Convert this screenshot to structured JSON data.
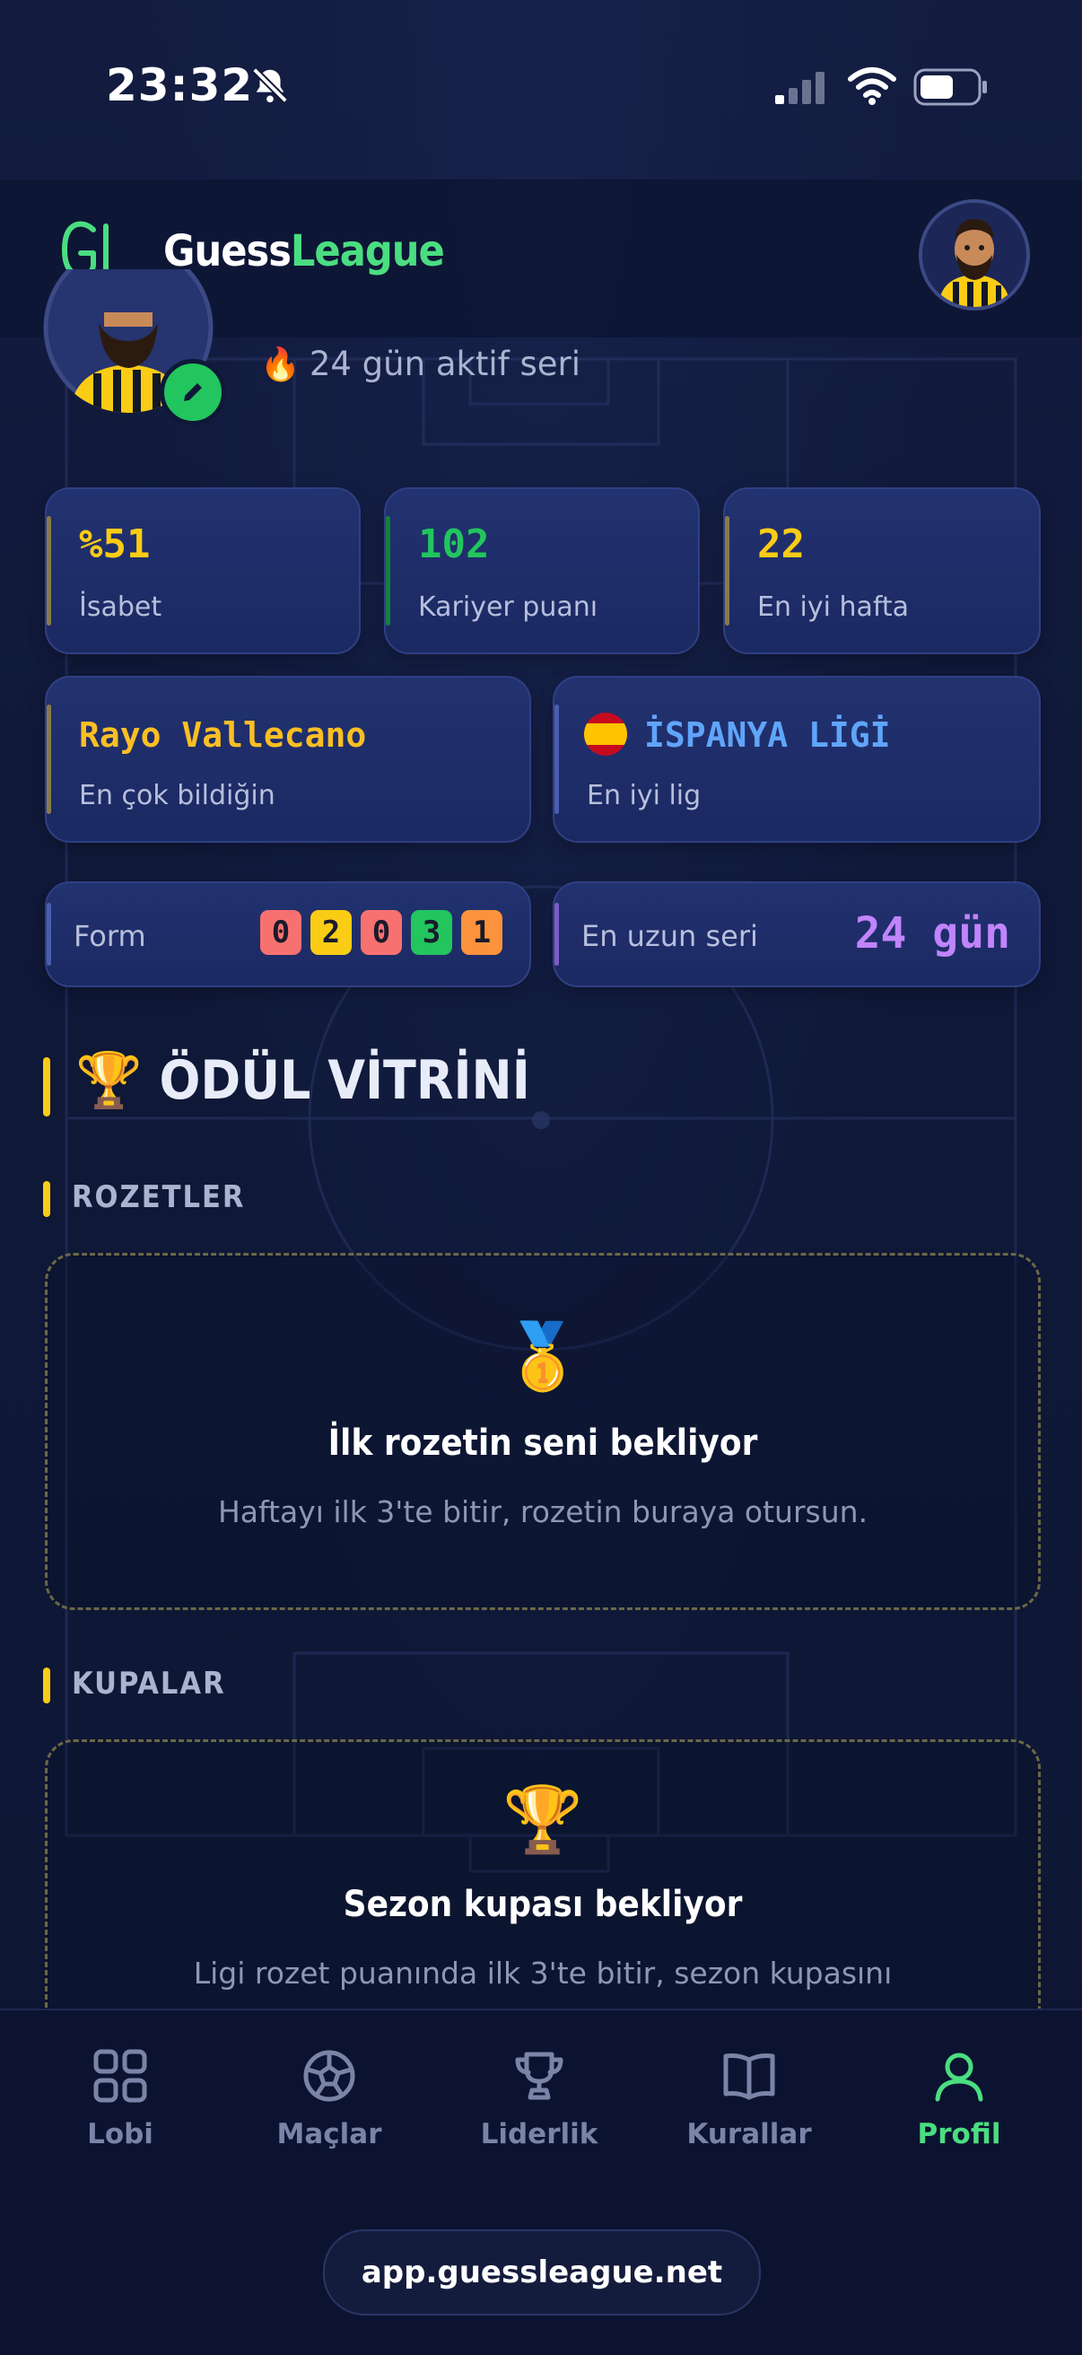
{
  "status_bar": {
    "time": "23:32"
  },
  "header": {
    "logo_text": "GL",
    "brand_part1": "Guess",
    "brand_part2": "League"
  },
  "profile": {
    "streak_text": "24 gün aktif seri"
  },
  "stats": [
    {
      "value": "%51",
      "label": "İsabet",
      "color": "#facc15"
    },
    {
      "value": "102",
      "label": "Kariyer puanı",
      "color": "#22c55e"
    },
    {
      "value": "22",
      "label": "En iyi hafta",
      "color": "#facc15"
    }
  ],
  "best_team": {
    "value": "Rayo Vallecano",
    "label": "En çok bildiğin",
    "color": "#fbbf24"
  },
  "best_league": {
    "value": "İSPANYA LİGİ",
    "label": "En iyi lig",
    "color": "#60a5fa"
  },
  "form": {
    "label": "Form",
    "results": [
      {
        "v": "0",
        "color": "#f87171"
      },
      {
        "v": "2",
        "color": "#facc15"
      },
      {
        "v": "0",
        "color": "#f87171"
      },
      {
        "v": "3",
        "color": "#22c55e"
      },
      {
        "v": "1",
        "color": "#fb923c"
      }
    ]
  },
  "longest_streak": {
    "label": "En uzun seri",
    "value": "24 gün"
  },
  "showcase": {
    "title": "ÖDÜL VİTRİNİ",
    "badges": {
      "heading": "ROZETLER",
      "empty_title": "İlk rozetin seni bekliyor",
      "empty_desc": "Haftayı ilk 3'te bitir, rozetin buraya otursun."
    },
    "trophies": {
      "heading": "KUPALAR",
      "empty_title": "Sezon kupası bekliyor",
      "empty_desc": "Ligi rozet puanında ilk 3'te bitir, sezon kupasını"
    }
  },
  "nav": {
    "items": [
      {
        "label": "Lobi",
        "icon": "grid-icon"
      },
      {
        "label": "Maçlar",
        "icon": "football-icon"
      },
      {
        "label": "Liderlik",
        "icon": "trophy-icon"
      },
      {
        "label": "Kurallar",
        "icon": "book-icon"
      },
      {
        "label": "Profil",
        "icon": "user-icon",
        "active": true
      }
    ]
  },
  "browser": {
    "url": "app.guessleague.net"
  }
}
